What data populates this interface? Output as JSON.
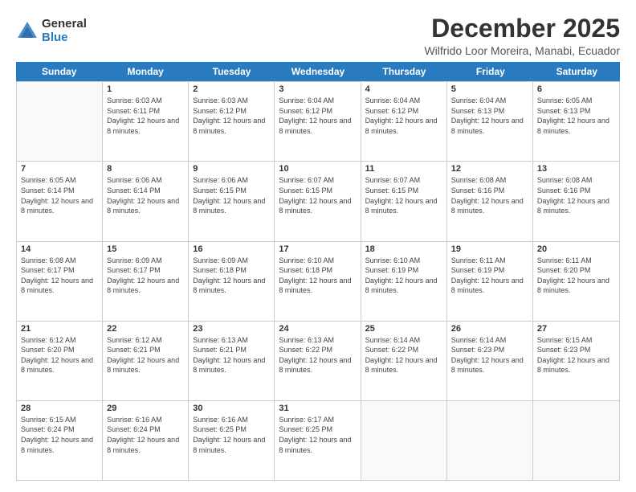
{
  "logo": {
    "general": "General",
    "blue": "Blue"
  },
  "title": "December 2025",
  "subtitle": "Wilfrido Loor Moreira, Manabi, Ecuador",
  "days": [
    "Sunday",
    "Monday",
    "Tuesday",
    "Wednesday",
    "Thursday",
    "Friday",
    "Saturday"
  ],
  "weeks": [
    [
      {
        "num": "",
        "sunrise": "",
        "sunset": "",
        "daylight": "",
        "empty": true
      },
      {
        "num": "1",
        "sunrise": "Sunrise: 6:03 AM",
        "sunset": "Sunset: 6:11 PM",
        "daylight": "Daylight: 12 hours and 8 minutes."
      },
      {
        "num": "2",
        "sunrise": "Sunrise: 6:03 AM",
        "sunset": "Sunset: 6:12 PM",
        "daylight": "Daylight: 12 hours and 8 minutes."
      },
      {
        "num": "3",
        "sunrise": "Sunrise: 6:04 AM",
        "sunset": "Sunset: 6:12 PM",
        "daylight": "Daylight: 12 hours and 8 minutes."
      },
      {
        "num": "4",
        "sunrise": "Sunrise: 6:04 AM",
        "sunset": "Sunset: 6:12 PM",
        "daylight": "Daylight: 12 hours and 8 minutes."
      },
      {
        "num": "5",
        "sunrise": "Sunrise: 6:04 AM",
        "sunset": "Sunset: 6:13 PM",
        "daylight": "Daylight: 12 hours and 8 minutes."
      },
      {
        "num": "6",
        "sunrise": "Sunrise: 6:05 AM",
        "sunset": "Sunset: 6:13 PM",
        "daylight": "Daylight: 12 hours and 8 minutes."
      }
    ],
    [
      {
        "num": "7",
        "sunrise": "Sunrise: 6:05 AM",
        "sunset": "Sunset: 6:14 PM",
        "daylight": "Daylight: 12 hours and 8 minutes."
      },
      {
        "num": "8",
        "sunrise": "Sunrise: 6:06 AM",
        "sunset": "Sunset: 6:14 PM",
        "daylight": "Daylight: 12 hours and 8 minutes."
      },
      {
        "num": "9",
        "sunrise": "Sunrise: 6:06 AM",
        "sunset": "Sunset: 6:15 PM",
        "daylight": "Daylight: 12 hours and 8 minutes."
      },
      {
        "num": "10",
        "sunrise": "Sunrise: 6:07 AM",
        "sunset": "Sunset: 6:15 PM",
        "daylight": "Daylight: 12 hours and 8 minutes."
      },
      {
        "num": "11",
        "sunrise": "Sunrise: 6:07 AM",
        "sunset": "Sunset: 6:15 PM",
        "daylight": "Daylight: 12 hours and 8 minutes."
      },
      {
        "num": "12",
        "sunrise": "Sunrise: 6:08 AM",
        "sunset": "Sunset: 6:16 PM",
        "daylight": "Daylight: 12 hours and 8 minutes."
      },
      {
        "num": "13",
        "sunrise": "Sunrise: 6:08 AM",
        "sunset": "Sunset: 6:16 PM",
        "daylight": "Daylight: 12 hours and 8 minutes."
      }
    ],
    [
      {
        "num": "14",
        "sunrise": "Sunrise: 6:08 AM",
        "sunset": "Sunset: 6:17 PM",
        "daylight": "Daylight: 12 hours and 8 minutes."
      },
      {
        "num": "15",
        "sunrise": "Sunrise: 6:09 AM",
        "sunset": "Sunset: 6:17 PM",
        "daylight": "Daylight: 12 hours and 8 minutes."
      },
      {
        "num": "16",
        "sunrise": "Sunrise: 6:09 AM",
        "sunset": "Sunset: 6:18 PM",
        "daylight": "Daylight: 12 hours and 8 minutes."
      },
      {
        "num": "17",
        "sunrise": "Sunrise: 6:10 AM",
        "sunset": "Sunset: 6:18 PM",
        "daylight": "Daylight: 12 hours and 8 minutes."
      },
      {
        "num": "18",
        "sunrise": "Sunrise: 6:10 AM",
        "sunset": "Sunset: 6:19 PM",
        "daylight": "Daylight: 12 hours and 8 minutes."
      },
      {
        "num": "19",
        "sunrise": "Sunrise: 6:11 AM",
        "sunset": "Sunset: 6:19 PM",
        "daylight": "Daylight: 12 hours and 8 minutes."
      },
      {
        "num": "20",
        "sunrise": "Sunrise: 6:11 AM",
        "sunset": "Sunset: 6:20 PM",
        "daylight": "Daylight: 12 hours and 8 minutes."
      }
    ],
    [
      {
        "num": "21",
        "sunrise": "Sunrise: 6:12 AM",
        "sunset": "Sunset: 6:20 PM",
        "daylight": "Daylight: 12 hours and 8 minutes."
      },
      {
        "num": "22",
        "sunrise": "Sunrise: 6:12 AM",
        "sunset": "Sunset: 6:21 PM",
        "daylight": "Daylight: 12 hours and 8 minutes."
      },
      {
        "num": "23",
        "sunrise": "Sunrise: 6:13 AM",
        "sunset": "Sunset: 6:21 PM",
        "daylight": "Daylight: 12 hours and 8 minutes."
      },
      {
        "num": "24",
        "sunrise": "Sunrise: 6:13 AM",
        "sunset": "Sunset: 6:22 PM",
        "daylight": "Daylight: 12 hours and 8 minutes."
      },
      {
        "num": "25",
        "sunrise": "Sunrise: 6:14 AM",
        "sunset": "Sunset: 6:22 PM",
        "daylight": "Daylight: 12 hours and 8 minutes."
      },
      {
        "num": "26",
        "sunrise": "Sunrise: 6:14 AM",
        "sunset": "Sunset: 6:23 PM",
        "daylight": "Daylight: 12 hours and 8 minutes."
      },
      {
        "num": "27",
        "sunrise": "Sunrise: 6:15 AM",
        "sunset": "Sunset: 6:23 PM",
        "daylight": "Daylight: 12 hours and 8 minutes."
      }
    ],
    [
      {
        "num": "28",
        "sunrise": "Sunrise: 6:15 AM",
        "sunset": "Sunset: 6:24 PM",
        "daylight": "Daylight: 12 hours and 8 minutes."
      },
      {
        "num": "29",
        "sunrise": "Sunrise: 6:16 AM",
        "sunset": "Sunset: 6:24 PM",
        "daylight": "Daylight: 12 hours and 8 minutes."
      },
      {
        "num": "30",
        "sunrise": "Sunrise: 6:16 AM",
        "sunset": "Sunset: 6:25 PM",
        "daylight": "Daylight: 12 hours and 8 minutes."
      },
      {
        "num": "31",
        "sunrise": "Sunrise: 6:17 AM",
        "sunset": "Sunset: 6:25 PM",
        "daylight": "Daylight: 12 hours and 8 minutes."
      },
      {
        "num": "",
        "sunrise": "",
        "sunset": "",
        "daylight": "",
        "empty": true
      },
      {
        "num": "",
        "sunrise": "",
        "sunset": "",
        "daylight": "",
        "empty": true
      },
      {
        "num": "",
        "sunrise": "",
        "sunset": "",
        "daylight": "",
        "empty": true
      }
    ]
  ]
}
